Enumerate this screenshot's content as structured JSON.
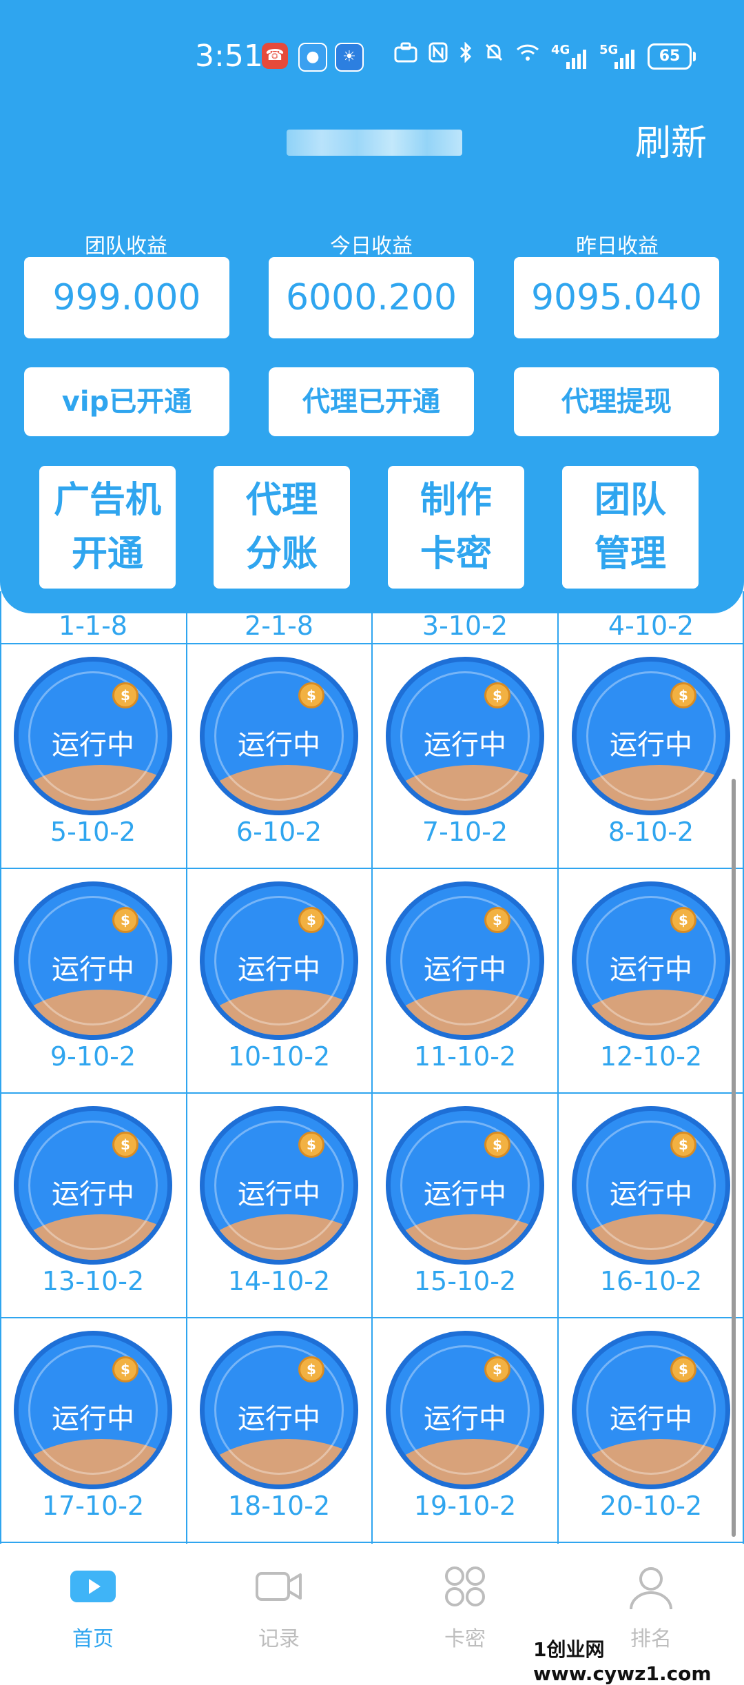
{
  "status_bar": {
    "time": "3:51",
    "net1": "4G",
    "net2": "5G",
    "battery": "65"
  },
  "header": {
    "refresh_label": "刷新"
  },
  "stats": [
    {
      "label": "团队收益",
      "value": "999.000"
    },
    {
      "label": "今日收益",
      "value": "6000.200"
    },
    {
      "label": "昨日收益",
      "value": "9095.040"
    }
  ],
  "pills": [
    "vip已开通",
    "代理已开通",
    "代理提现"
  ],
  "tiles": [
    {
      "line1": "广告机",
      "line2": "开通"
    },
    {
      "line1": "代理",
      "line2": "分账"
    },
    {
      "line1": "制作",
      "line2": "卡密"
    },
    {
      "line1": "团队",
      "line2": "管理"
    }
  ],
  "grid": {
    "top_labels": [
      "1-1-8",
      "2-1-8",
      "3-10-2",
      "4-10-2"
    ],
    "cells": [
      {
        "status": "运行中",
        "label": "5-10-2"
      },
      {
        "status": "运行中",
        "label": "6-10-2"
      },
      {
        "status": "运行中",
        "label": "7-10-2"
      },
      {
        "status": "运行中",
        "label": "8-10-2"
      },
      {
        "status": "运行中",
        "label": "9-10-2"
      },
      {
        "status": "运行中",
        "label": "10-10-2"
      },
      {
        "status": "运行中",
        "label": "11-10-2"
      },
      {
        "status": "运行中",
        "label": "12-10-2"
      },
      {
        "status": "运行中",
        "label": "13-10-2"
      },
      {
        "status": "运行中",
        "label": "14-10-2"
      },
      {
        "status": "运行中",
        "label": "15-10-2"
      },
      {
        "status": "运行中",
        "label": "16-10-2"
      },
      {
        "status": "运行中",
        "label": "17-10-2"
      },
      {
        "status": "运行中",
        "label": "18-10-2"
      },
      {
        "status": "运行中",
        "label": "19-10-2"
      },
      {
        "status": "运行中",
        "label": "20-10-2"
      }
    ],
    "coin_symbol": "$"
  },
  "nav": [
    {
      "label": "首页",
      "icon": "play-icon",
      "active": true
    },
    {
      "label": "记录",
      "icon": "video-camera-icon",
      "active": false
    },
    {
      "label": "卡密",
      "icon": "four-circles-icon",
      "active": false
    },
    {
      "label": "排名",
      "icon": "person-icon",
      "active": false
    }
  ],
  "watermark": "1创业网www.cywz1.com",
  "colors": {
    "primary": "#2fa5ef",
    "bubble": "#2e8ef3",
    "coin": "#f2b142",
    "sand": "#d8a27a",
    "nav_inactive": "#bdbdbd"
  }
}
